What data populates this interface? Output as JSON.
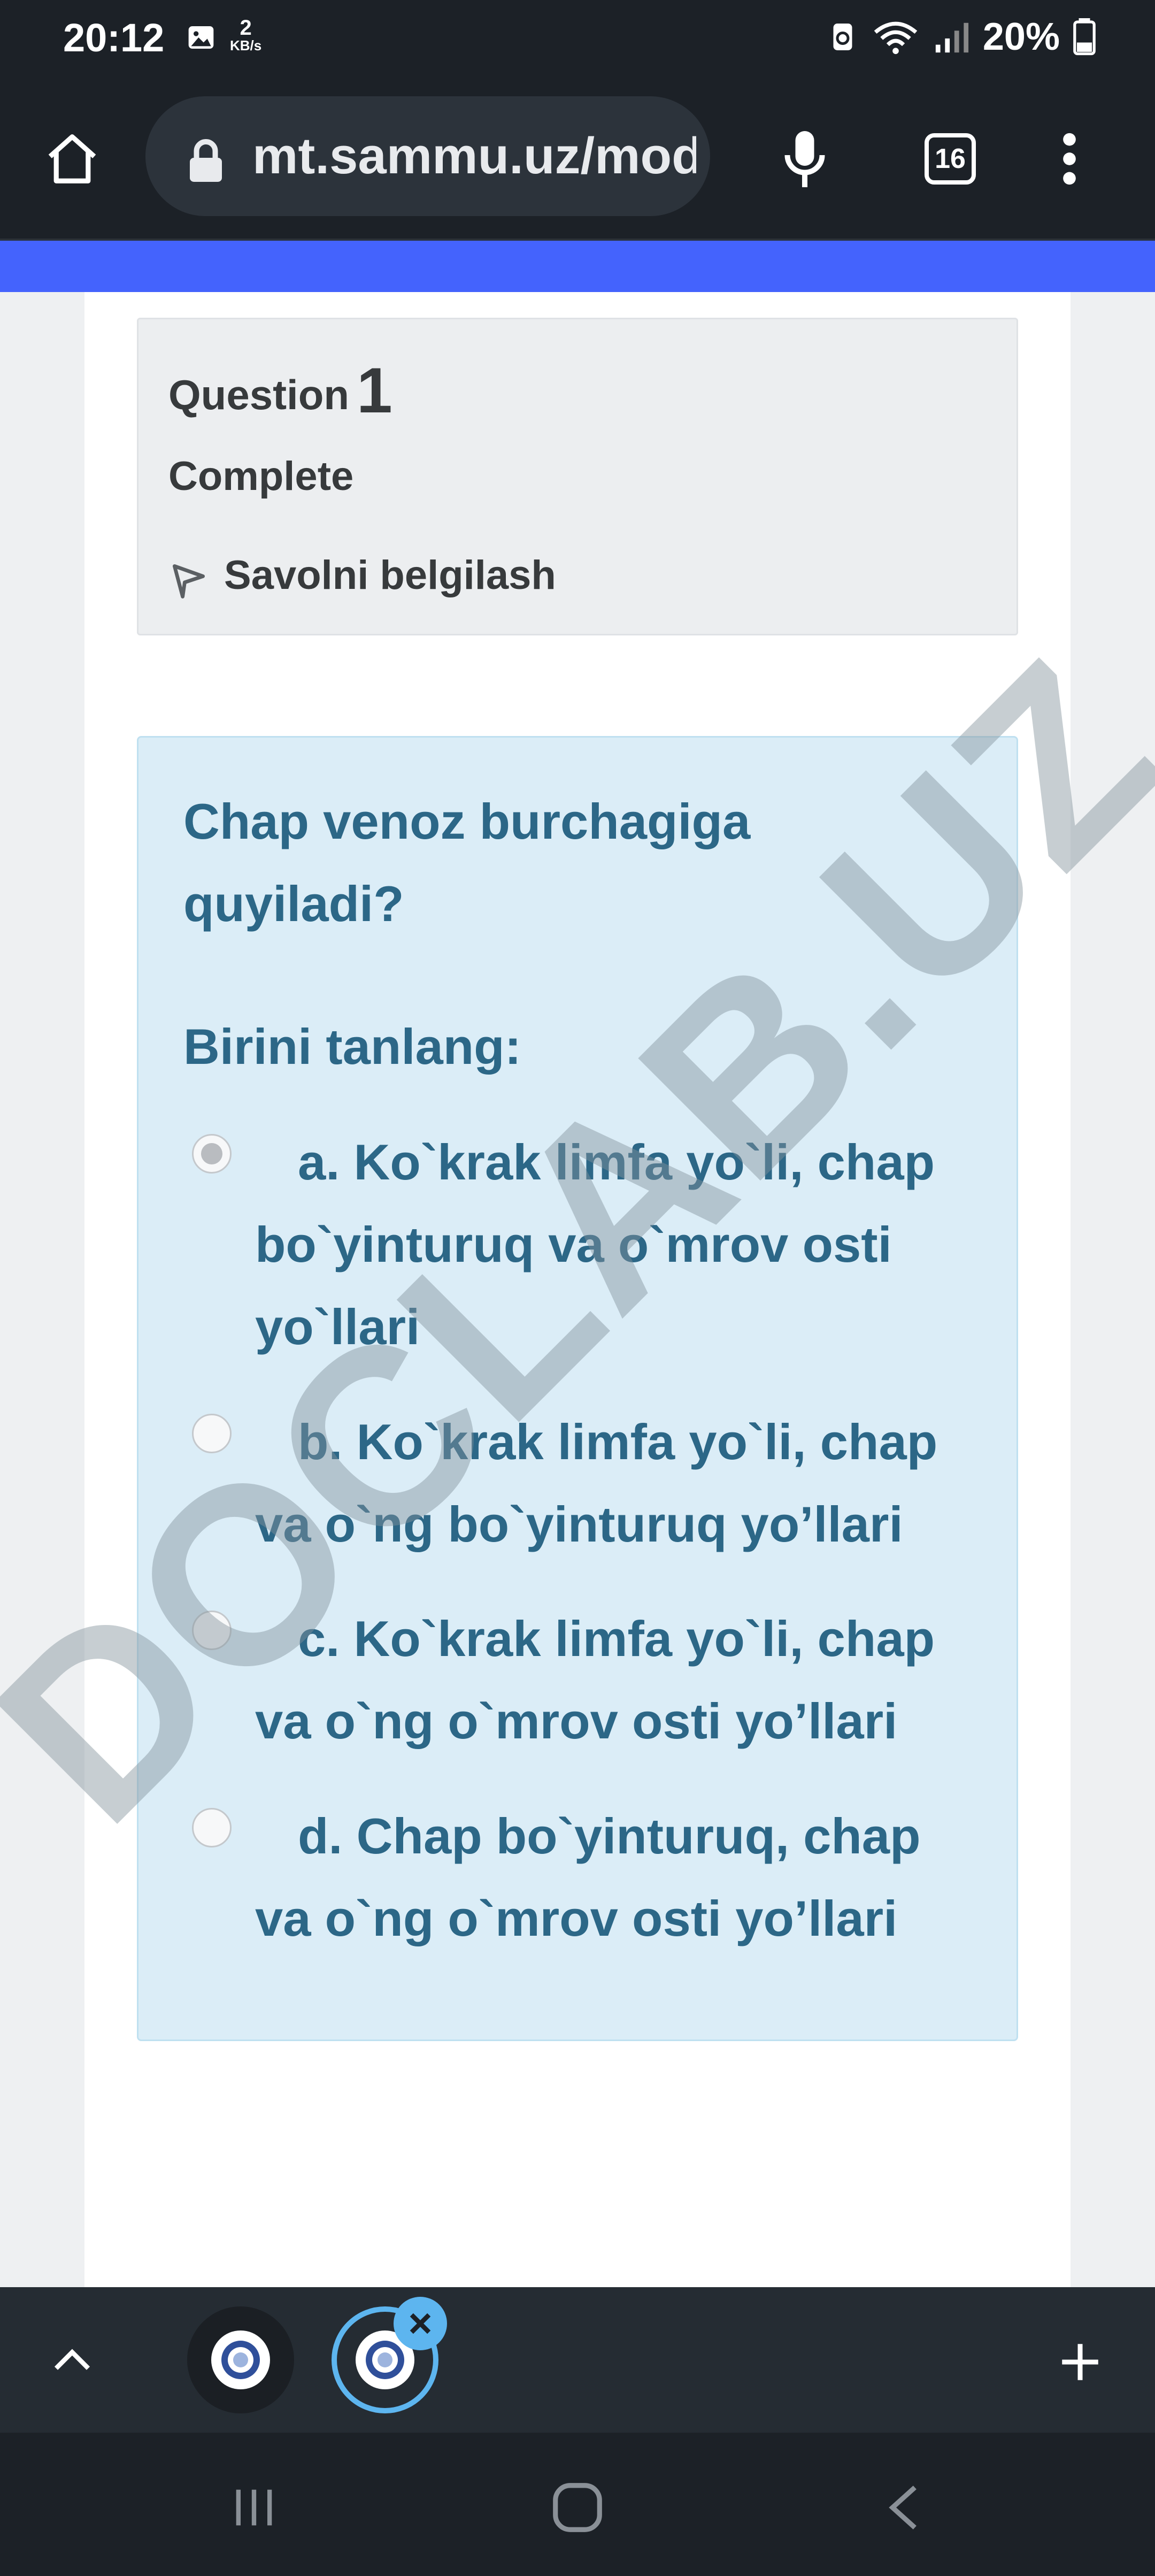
{
  "status_bar": {
    "time": "20:12",
    "net_speed": "2",
    "net_unit": "KB/s",
    "battery": "20%"
  },
  "browser": {
    "url": "mt.sammu.uz/mod/quiz",
    "tab_count": "16"
  },
  "question_info": {
    "label": "Question",
    "number": "1",
    "status": "Complete",
    "flag_label": "Savolni belgilash"
  },
  "question": {
    "text": "Chap venoz burchagiga quyiladi?",
    "prompt": "Birini tanlang:",
    "options": [
      {
        "label": "a. Ko`krak limfa yo`li, chap bo`yinturuq va o`mrov osti yo`llari",
        "selected": true
      },
      {
        "label": "b. Ko`krak limfa yo`li, chap va o`ng bo`yinturuq yo’llari",
        "selected": false
      },
      {
        "label": "c. Ko`krak limfa yo`li, chap va o`ng o`mrov osti yo’llari",
        "selected": false
      },
      {
        "label": "d. Chap bo`yinturuq, chap va o`ng o`mrov osti yo’llari",
        "selected": false
      }
    ]
  },
  "watermark": "DOCLAB.UZ",
  "colors": {
    "toolbar": "#1c2127",
    "accent_strip": "#4463fd",
    "question_bg": "#dbedf7",
    "question_text": "#2c6787",
    "active_tab_ring": "#5db5ef"
  },
  "icons": [
    "home-icon",
    "lock-icon",
    "mic-icon",
    "tabs-icon",
    "menu-icon",
    "flag-icon",
    "chevron-up-icon",
    "close-icon",
    "plus-icon",
    "recents-icon",
    "home-nav-icon",
    "back-icon"
  ]
}
